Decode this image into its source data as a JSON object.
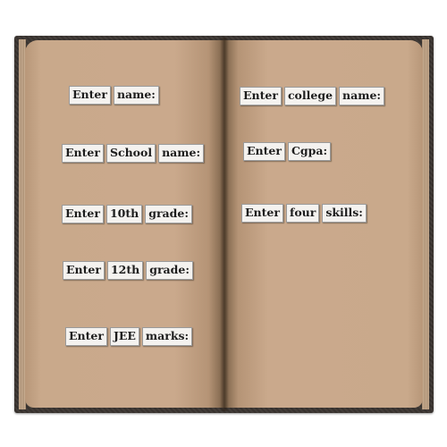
{
  "book": {
    "left_page": [
      {
        "name": "name-prompt",
        "words": [
          "Enter",
          "name:"
        ]
      },
      {
        "name": "school-name-prompt",
        "words": [
          "Enter",
          "School",
          "name:"
        ]
      },
      {
        "name": "10th-grade-prompt",
        "words": [
          "Enter",
          "10th",
          "grade:"
        ]
      },
      {
        "name": "12th-grade-prompt",
        "words": [
          "Enter",
          "12th",
          "grade:"
        ]
      },
      {
        "name": "jee-marks-prompt",
        "words": [
          "Enter",
          "JEE",
          "marks:"
        ]
      }
    ],
    "right_page": [
      {
        "name": "college-name-prompt",
        "words": [
          "Enter",
          "college",
          "name:"
        ]
      },
      {
        "name": "cgpa-prompt",
        "words": [
          "Enter",
          "Cgpa:"
        ]
      },
      {
        "name": "four-skills-prompt",
        "words": [
          "Enter",
          "four",
          "skills:"
        ]
      }
    ]
  },
  "colors": {
    "cover": "#3a3430",
    "page": "#c9a98b",
    "label_bg": "#f4f2ef"
  }
}
